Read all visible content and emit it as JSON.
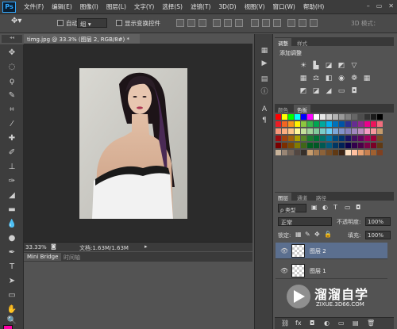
{
  "app": {
    "logo": "Ps"
  },
  "menu": [
    "文件(F)",
    "编辑(E)",
    "图像(I)",
    "图层(L)",
    "文字(Y)",
    "选择(S)",
    "滤镜(T)",
    "3D(D)",
    "视图(V)",
    "窗口(W)",
    "帮助(H)"
  ],
  "window_controls": {
    "minimize": "–",
    "restore": "▭",
    "close": "✕"
  },
  "options_bar": {
    "auto_select_label": "自动选择：",
    "auto_select_target": "组",
    "show_transform_label": "显示变换控件",
    "mode_3d": "3D 模式："
  },
  "document": {
    "tab_title": "timg.jpg @ 33.3% (图层 2, RGB/8#) *",
    "zoom": "33.33%",
    "doc_info": "文档:1.63M/1.63M"
  },
  "bottom_tabs": [
    "Mini Bridge",
    "时间轴"
  ],
  "adjustments": {
    "tabs": [
      "调整",
      "样式"
    ],
    "title": "添加调整"
  },
  "swatches_panel": {
    "tabs": [
      "颜色",
      "色板"
    ]
  },
  "layers_panel": {
    "tabs": [
      "图层",
      "通道",
      "路径"
    ],
    "filter_type": "ρ 类型",
    "blend_mode": "正常",
    "opacity_label": "不透明度:",
    "opacity_value": "100%",
    "lock_label": "锁定:",
    "fill_label": "填充:",
    "fill_value": "100%",
    "layers": [
      {
        "name": "图层 2",
        "selected": true
      },
      {
        "name": "图层 1",
        "selected": false
      }
    ]
  },
  "watermark": {
    "title": "溜溜自学",
    "url": "ZIXUE.3D66.COM"
  },
  "colors": {
    "accent": "#31a8ff",
    "foreground": "#ff00a8",
    "background": "#ffffff"
  }
}
